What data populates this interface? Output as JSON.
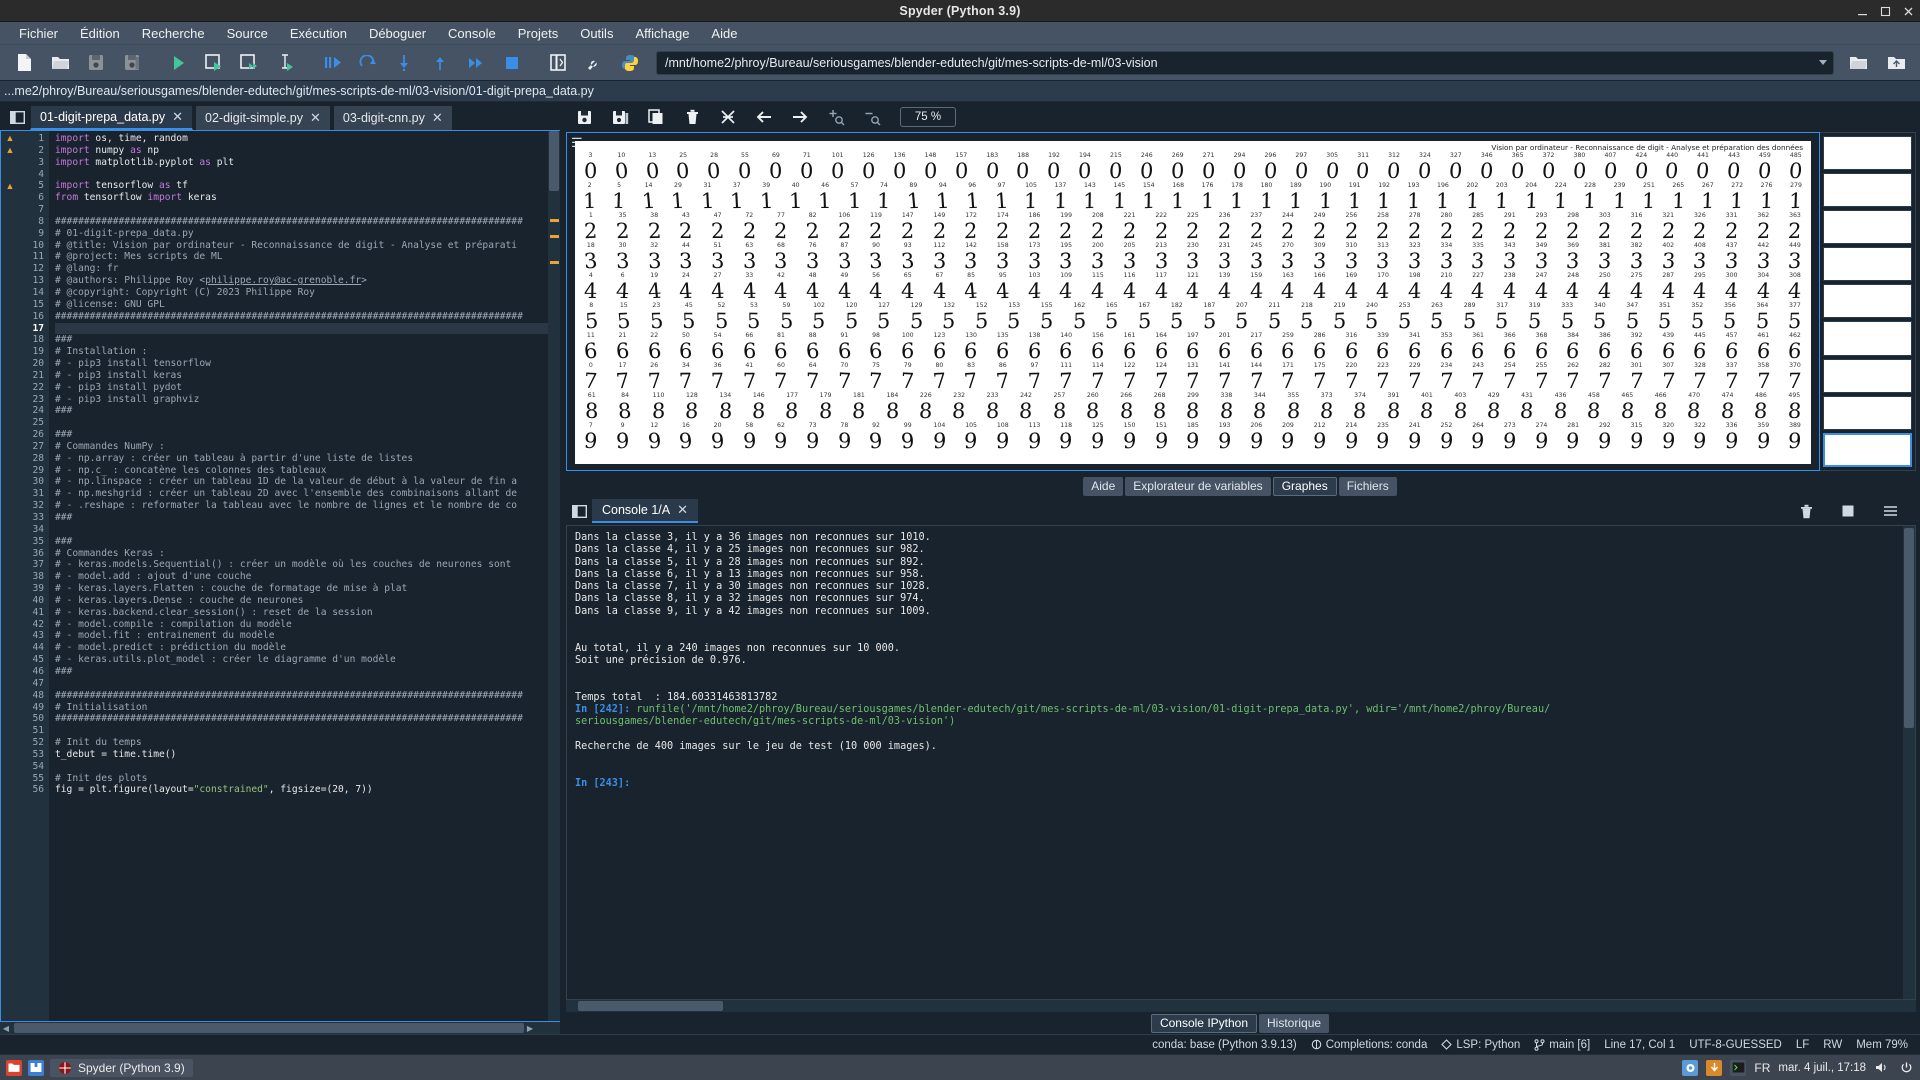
{
  "window": {
    "title": "Spyder (Python 3.9)",
    "minimize": "minimize-icon",
    "maximize": "maximize-icon",
    "close": "close-icon"
  },
  "menubar": {
    "items": [
      "Fichier",
      "Édition",
      "Recherche",
      "Source",
      "Exécution",
      "Déboguer",
      "Console",
      "Projets",
      "Outils",
      "Affichage",
      "Aide"
    ]
  },
  "toolbar": {
    "buttons": [
      "new-file",
      "open-file",
      "save-file",
      "save-all",
      "run-file",
      "run-cell",
      "run-cell-advance",
      "run-selection",
      "debug-file",
      "debug-continue",
      "debug-step-into",
      "debug-step-return",
      "debug-step-over",
      "stop-debug",
      "maximize-pane",
      "preferences",
      "python-path"
    ],
    "path_value": "/mnt/home2/phroy/Bureau/seriousgames/blender-edutech/git/mes-scripts-de-ml/03-vision",
    "browse_label": "open-folder-icon",
    "pythonpath_label": "pythonpath-icon"
  },
  "breadcrumb": {
    "path": "...me2/phroy/Bureau/seriousgames/blender-edutech/git/mes-scripts-de-ml/03-vision/01-digit-prepa_data.py"
  },
  "editor": {
    "tabs": [
      {
        "label": "01-digit-prepa_data.py",
        "active": true
      },
      {
        "label": "02-digit-simple.py",
        "active": false
      },
      {
        "label": "03-digit-cnn.py",
        "active": false
      }
    ],
    "current_line": 17,
    "warning_lines": [
      1,
      2,
      5
    ],
    "lines": [
      {
        "n": 1,
        "html": "<span class='kw'>import</span> os, time, random"
      },
      {
        "n": 2,
        "html": "<span class='kw'>import</span> numpy <span class='kw'>as</span> np"
      },
      {
        "n": 3,
        "html": "<span class='kw'>import</span> matplotlib.pyplot <span class='kw'>as</span> plt"
      },
      {
        "n": 4,
        "html": ""
      },
      {
        "n": 5,
        "html": "<span class='kw'>import</span> tensorflow <span class='kw'>as</span> tf"
      },
      {
        "n": 6,
        "html": "<span class='kw'>from</span> tensorflow <span class='kw'>import</span> keras"
      },
      {
        "n": 7,
        "html": ""
      },
      {
        "n": 8,
        "html": "<span class='cm'>#################################################################################</span>"
      },
      {
        "n": 9,
        "html": "<span class='cm'># 01-digit-prepa_data.py</span>"
      },
      {
        "n": 10,
        "html": "<span class='cm'># @title: Vision par ordinateur - Reconnaissance de digit - Analyse et préparati</span>"
      },
      {
        "n": 11,
        "html": "<span class='cm'># @project: Mes scripts de ML</span>"
      },
      {
        "n": 12,
        "html": "<span class='cm'># @lang: fr</span>"
      },
      {
        "n": 13,
        "html": "<span class='cm'># @authors: Philippe Roy &lt;<span class='link'>philippe.roy@ac-grenoble.fr</span>&gt;</span>"
      },
      {
        "n": 14,
        "html": "<span class='cm'># @copyright: Copyright (C) 2023 Philippe Roy</span>"
      },
      {
        "n": 15,
        "html": "<span class='cm'># @license: GNU GPL</span>"
      },
      {
        "n": 16,
        "html": "<span class='cm'>#################################################################################</span>"
      },
      {
        "n": 17,
        "html": ""
      },
      {
        "n": 18,
        "html": "<span class='cm'>###</span>"
      },
      {
        "n": 19,
        "html": "<span class='cm'># Installation :</span>"
      },
      {
        "n": 20,
        "html": "<span class='cm'># - pip3 install tensorflow</span>"
      },
      {
        "n": 21,
        "html": "<span class='cm'># - pip3 install keras</span>"
      },
      {
        "n": 22,
        "html": "<span class='cm'># - pip3 install pydot</span>"
      },
      {
        "n": 23,
        "html": "<span class='cm'># - pip3 install graphviz</span>"
      },
      {
        "n": 24,
        "html": "<span class='cm'>###</span>"
      },
      {
        "n": 25,
        "html": ""
      },
      {
        "n": 26,
        "html": "<span class='cm'>###</span>"
      },
      {
        "n": 27,
        "html": "<span class='cm'># Commandes NumPy :</span>"
      },
      {
        "n": 28,
        "html": "<span class='cm'># - np.array : créer un tableau à partir d'une liste de listes</span>"
      },
      {
        "n": 29,
        "html": "<span class='cm'># - np.c_ : concatène les colonnes des tableaux</span>"
      },
      {
        "n": 30,
        "html": "<span class='cm'># - np.linspace : créer un tableau 1D de la valeur de début à la valeur de fin a</span>"
      },
      {
        "n": 31,
        "html": "<span class='cm'># - np.meshgrid : créer un tableau 2D avec l'ensemble des combinaisons allant de</span>"
      },
      {
        "n": 32,
        "html": "<span class='cm'># - .reshape : reformater la tableau avec le nombre de lignes et le nombre de co</span>"
      },
      {
        "n": 33,
        "html": "<span class='cm'>###</span>"
      },
      {
        "n": 34,
        "html": ""
      },
      {
        "n": 35,
        "html": "<span class='cm'>###</span>"
      },
      {
        "n": 36,
        "html": "<span class='cm'># Commandes Keras :</span>"
      },
      {
        "n": 37,
        "html": "<span class='cm'># - keras.models.Sequential() : créer un modèle où les couches de neurones sont</span>"
      },
      {
        "n": 38,
        "html": "<span class='cm'># - model.add : ajout d'une couche</span>"
      },
      {
        "n": 39,
        "html": "<span class='cm'># - keras.layers.Flatten : couche de formatage de mise à plat</span>"
      },
      {
        "n": 40,
        "html": "<span class='cm'># - keras.layers.Dense : couche de neurones</span>"
      },
      {
        "n": 41,
        "html": "<span class='cm'># - keras.backend.clear_session() : reset de la session</span>"
      },
      {
        "n": 42,
        "html": "<span class='cm'># - model.compile : compilation du modèle</span>"
      },
      {
        "n": 43,
        "html": "<span class='cm'># - model.fit : entrainement du modèle</span>"
      },
      {
        "n": 44,
        "html": "<span class='cm'># - model.predict : prédiction du modèle</span>"
      },
      {
        "n": 45,
        "html": "<span class='cm'># - keras.utils.plot_model : créer le diagramme d'un modèle</span>"
      },
      {
        "n": 46,
        "html": "<span class='cm'>###</span>"
      },
      {
        "n": 47,
        "html": ""
      },
      {
        "n": 48,
        "html": "<span class='cm'>#################################################################################</span>"
      },
      {
        "n": 49,
        "html": "<span class='cm'># Initialisation</span>"
      },
      {
        "n": 50,
        "html": "<span class='cm'>#################################################################################</span>"
      },
      {
        "n": 51,
        "html": ""
      },
      {
        "n": 52,
        "html": "<span class='cm'># Init du temps</span>"
      },
      {
        "n": 53,
        "html": "t_debut = time.time()"
      },
      {
        "n": 54,
        "html": ""
      },
      {
        "n": 55,
        "html": "<span class='cm'># Init des plots</span>"
      },
      {
        "n": 56,
        "html": "fig = plt.figure(layout=<span class='st'>\"constrained\"</span>, figsize=(20, 7))"
      }
    ]
  },
  "plots": {
    "toolbar_buttons": [
      "save-plot",
      "save-all-plots",
      "copy-plot",
      "remove-plot",
      "remove-all-plots",
      "previous-plot",
      "next-plot",
      "zoom-in",
      "zoom-out"
    ],
    "zoom_level": "75 %",
    "options_icon": "hamburger-icon",
    "figure_title": "Vision par ordinateur - Reconnaissance de digit - Analyse et préparation des données",
    "rows": [
      {
        "digit": "0",
        "ids": [
          "3",
          "10",
          "13",
          "25",
          "28",
          "55",
          "69",
          "71",
          "101",
          "126",
          "136",
          "148",
          "157",
          "183",
          "188",
          "192",
          "194",
          "215",
          "246",
          "269",
          "271",
          "294",
          "296",
          "297",
          "305",
          "311",
          "312",
          "324",
          "327",
          "346",
          "365",
          "372",
          "380",
          "407",
          "424",
          "440",
          "441",
          "443",
          "459",
          "485"
        ]
      },
      {
        "digit": "1",
        "ids": [
          "2",
          "5",
          "14",
          "29",
          "31",
          "37",
          "39",
          "40",
          "46",
          "57",
          "74",
          "89",
          "94",
          "96",
          "97",
          "105",
          "137",
          "143",
          "145",
          "154",
          "168",
          "176",
          "178",
          "180",
          "189",
          "190",
          "191",
          "192",
          "193",
          "196",
          "202",
          "203",
          "204",
          "224",
          "228",
          "239",
          "251",
          "265",
          "267",
          "272",
          "276",
          "279"
        ]
      },
      {
        "digit": "2",
        "ids": [
          "1",
          "35",
          "38",
          "43",
          "47",
          "72",
          "77",
          "82",
          "106",
          "119",
          "147",
          "149",
          "172",
          "174",
          "186",
          "199",
          "208",
          "221",
          "222",
          "225",
          "236",
          "237",
          "244",
          "249",
          "256",
          "258",
          "278",
          "280",
          "285",
          "291",
          "293",
          "298",
          "303",
          "316",
          "321",
          "326",
          "331",
          "362",
          "363"
        ]
      },
      {
        "digit": "3",
        "ids": [
          "18",
          "30",
          "32",
          "44",
          "51",
          "63",
          "68",
          "76",
          "87",
          "90",
          "93",
          "112",
          "142",
          "158",
          "173",
          "195",
          "200",
          "205",
          "213",
          "230",
          "231",
          "245",
          "270",
          "309",
          "310",
          "313",
          "323",
          "334",
          "335",
          "343",
          "349",
          "369",
          "381",
          "382",
          "402",
          "408",
          "437",
          "442",
          "449"
        ]
      },
      {
        "digit": "4",
        "ids": [
          "4",
          "6",
          "19",
          "24",
          "27",
          "33",
          "42",
          "48",
          "49",
          "56",
          "65",
          "67",
          "85",
          "95",
          "103",
          "109",
          "115",
          "116",
          "117",
          "121",
          "139",
          "159",
          "163",
          "166",
          "169",
          "170",
          "198",
          "210",
          "227",
          "238",
          "247",
          "248",
          "250",
          "275",
          "287",
          "295",
          "300",
          "304",
          "308"
        ]
      },
      {
        "digit": "5",
        "ids": [
          "8",
          "15",
          "23",
          "45",
          "52",
          "53",
          "59",
          "102",
          "120",
          "127",
          "129",
          "132",
          "152",
          "153",
          "155",
          "162",
          "165",
          "167",
          "182",
          "187",
          "207",
          "211",
          "218",
          "219",
          "240",
          "253",
          "263",
          "289",
          "317",
          "319",
          "333",
          "340",
          "347",
          "351",
          "352",
          "356",
          "364",
          "377"
        ]
      },
      {
        "digit": "6",
        "ids": [
          "11",
          "21",
          "22",
          "50",
          "54",
          "66",
          "81",
          "88",
          "91",
          "98",
          "100",
          "123",
          "130",
          "135",
          "138",
          "140",
          "156",
          "161",
          "164",
          "197",
          "201",
          "217",
          "259",
          "286",
          "316",
          "339",
          "341",
          "353",
          "361",
          "366",
          "368",
          "384",
          "386",
          "392",
          "439",
          "445",
          "457",
          "461",
          "462"
        ]
      },
      {
        "digit": "7",
        "ids": [
          "0",
          "17",
          "26",
          "34",
          "36",
          "41",
          "60",
          "64",
          "70",
          "75",
          "79",
          "80",
          "83",
          "86",
          "97",
          "111",
          "114",
          "122",
          "124",
          "131",
          "141",
          "144",
          "171",
          "175",
          "220",
          "223",
          "229",
          "234",
          "243",
          "254",
          "255",
          "262",
          "282",
          "301",
          "307",
          "328",
          "337",
          "358",
          "370"
        ]
      },
      {
        "digit": "8",
        "ids": [
          "61",
          "84",
          "110",
          "128",
          "134",
          "146",
          "177",
          "179",
          "181",
          "184",
          "226",
          "232",
          "233",
          "242",
          "257",
          "260",
          "266",
          "268",
          "299",
          "338",
          "344",
          "355",
          "373",
          "374",
          "391",
          "401",
          "403",
          "429",
          "431",
          "436",
          "458",
          "465",
          "466",
          "470",
          "474",
          "486",
          "495"
        ]
      },
      {
        "digit": "9",
        "ids": [
          "7",
          "9",
          "12",
          "16",
          "20",
          "58",
          "62",
          "73",
          "78",
          "92",
          "99",
          "104",
          "105",
          "108",
          "113",
          "118",
          "125",
          "150",
          "151",
          "185",
          "193",
          "206",
          "209",
          "212",
          "214",
          "235",
          "241",
          "252",
          "264",
          "273",
          "274",
          "281",
          "292",
          "315",
          "320",
          "322",
          "336",
          "359",
          "389"
        ]
      }
    ],
    "tabs": [
      {
        "label": "Aide",
        "active": false
      },
      {
        "label": "Explorateur de variables",
        "active": false
      },
      {
        "label": "Graphes",
        "active": true
      },
      {
        "label": "Fichiers",
        "active": false
      }
    ]
  },
  "console": {
    "tab_label": "Console 1/A",
    "pane_icon": "pane-icon",
    "tools": [
      "remove-all-variables",
      "interrupt-kernel",
      "options-menu"
    ],
    "output_lines": [
      {
        "text": "Dans la classe 3, il y a 36 images non reconnues sur 1010.",
        "type": "plain"
      },
      {
        "text": "Dans la classe 4, il y a 25 images non reconnues sur 982.",
        "type": "plain"
      },
      {
        "text": "Dans la classe 5, il y a 28 images non reconnues sur 892.",
        "type": "plain"
      },
      {
        "text": "Dans la classe 6, il y a 13 images non reconnues sur 958.",
        "type": "plain"
      },
      {
        "text": "Dans la classe 7, il y a 30 images non reconnues sur 1028.",
        "type": "plain"
      },
      {
        "text": "Dans la classe 8, il y a 32 images non reconnues sur 974.",
        "type": "plain"
      },
      {
        "text": "Dans la classe 9, il y a 42 images non reconnues sur 1009.",
        "type": "plain"
      },
      {
        "text": "",
        "type": "plain"
      },
      {
        "text": "",
        "type": "plain"
      },
      {
        "text": "Au total, il y a 240 images non reconnues sur 10 000.",
        "type": "plain"
      },
      {
        "text": "Soit une précision de 0.976.",
        "type": "plain"
      },
      {
        "text": "",
        "type": "plain"
      },
      {
        "text": "",
        "type": "plain"
      },
      {
        "text": "Temps total  : 184.60331463813782",
        "type": "plain"
      }
    ],
    "prompt_in": "In [242]:",
    "command_text": " runfile('/mnt/home2/phroy/Bureau/seriousgames/blender-edutech/git/mes-scripts-de-ml/03-vision/01-digit-prepa_data.py', wdir='/mnt/home2/phroy/Bureau/",
    "command_text2": "seriousgames/blender-edutech/git/mes-scripts-de-ml/03-vision')",
    "post_lines": [
      "",
      "Recherche de 400 images sur le jeu de test (10 000 images).",
      "",
      ""
    ],
    "prompt_next": "In [243]:",
    "bottom_tabs": [
      {
        "label": "Console IPython",
        "active": true
      },
      {
        "label": "Historique",
        "active": false
      }
    ]
  },
  "statusbar": {
    "conda": "conda: base (Python 3.9.13)",
    "completions": "Completions: conda",
    "lsp": "LSP: Python",
    "branch": "main [6]",
    "cursor": "Line 17, Col 1",
    "encoding": "UTF-8-GUESSED",
    "eol": "LF",
    "permissions": "RW",
    "memory": "Mem 79%"
  },
  "taskbar": {
    "app_label": "Spyder (Python 3.9)",
    "lang": "FR",
    "clock": "mar.  4 juil., 17:18",
    "icons": [
      "files-icon",
      "archive-icon",
      "terminal-icon",
      "spyder-icon",
      "blender-icon",
      "keyboard-icon",
      "volume-icon",
      "power-icon"
    ]
  },
  "colors": {
    "accent": "#3a8ee6",
    "panel": "#19232d",
    "chrome": "#455364",
    "warning": "#e8a33d",
    "green": "#6fbf6f"
  }
}
